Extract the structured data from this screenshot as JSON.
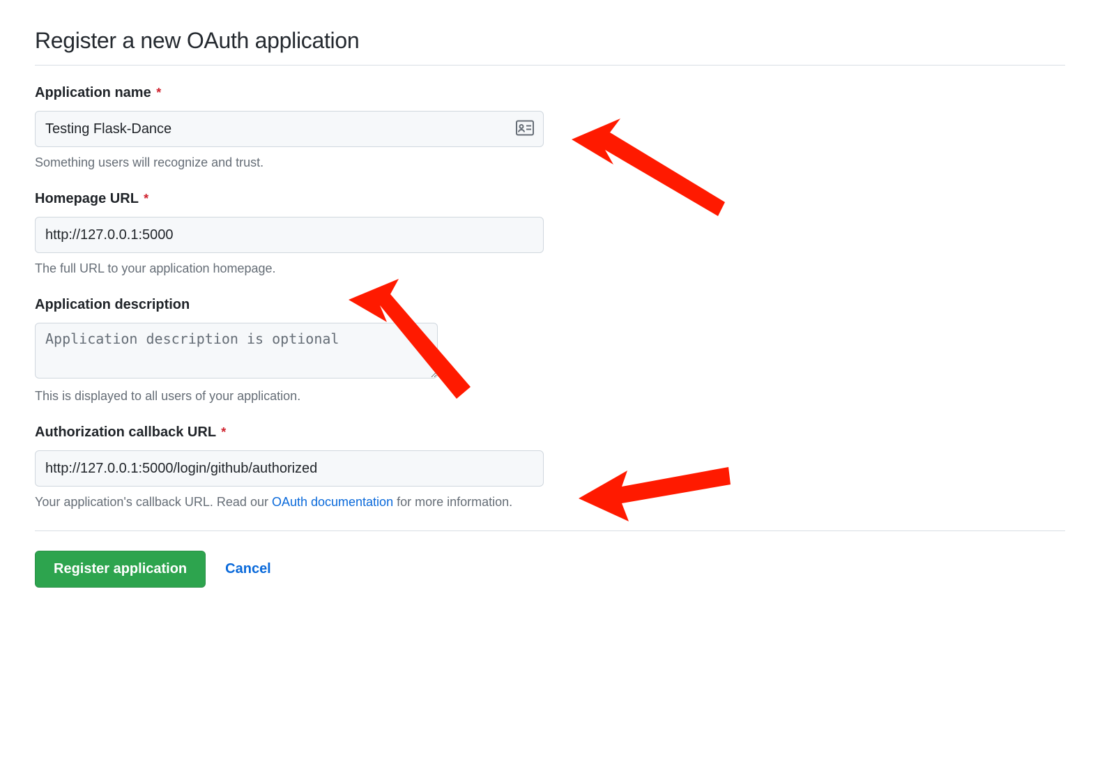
{
  "page_title": "Register a new OAuth application",
  "fields": {
    "app_name": {
      "label": "Application name",
      "value": "Testing Flask-Dance",
      "help": "Something users will recognize and trust.",
      "required": true
    },
    "homepage_url": {
      "label": "Homepage URL",
      "value": "http://127.0.0.1:5000",
      "help": "The full URL to your application homepage.",
      "required": true
    },
    "description": {
      "label": "Application description",
      "placeholder": "Application description is optional",
      "help": "This is displayed to all users of your application.",
      "required": false
    },
    "callback_url": {
      "label": "Authorization callback URL",
      "value": "http://127.0.0.1:5000/login/github/authorized",
      "help_prefix": "Your application's callback URL. Read our ",
      "help_link_text": "OAuth documentation",
      "help_suffix": " for more information.",
      "required": true
    }
  },
  "actions": {
    "submit": "Register application",
    "cancel": "Cancel"
  },
  "required_marker": "*"
}
